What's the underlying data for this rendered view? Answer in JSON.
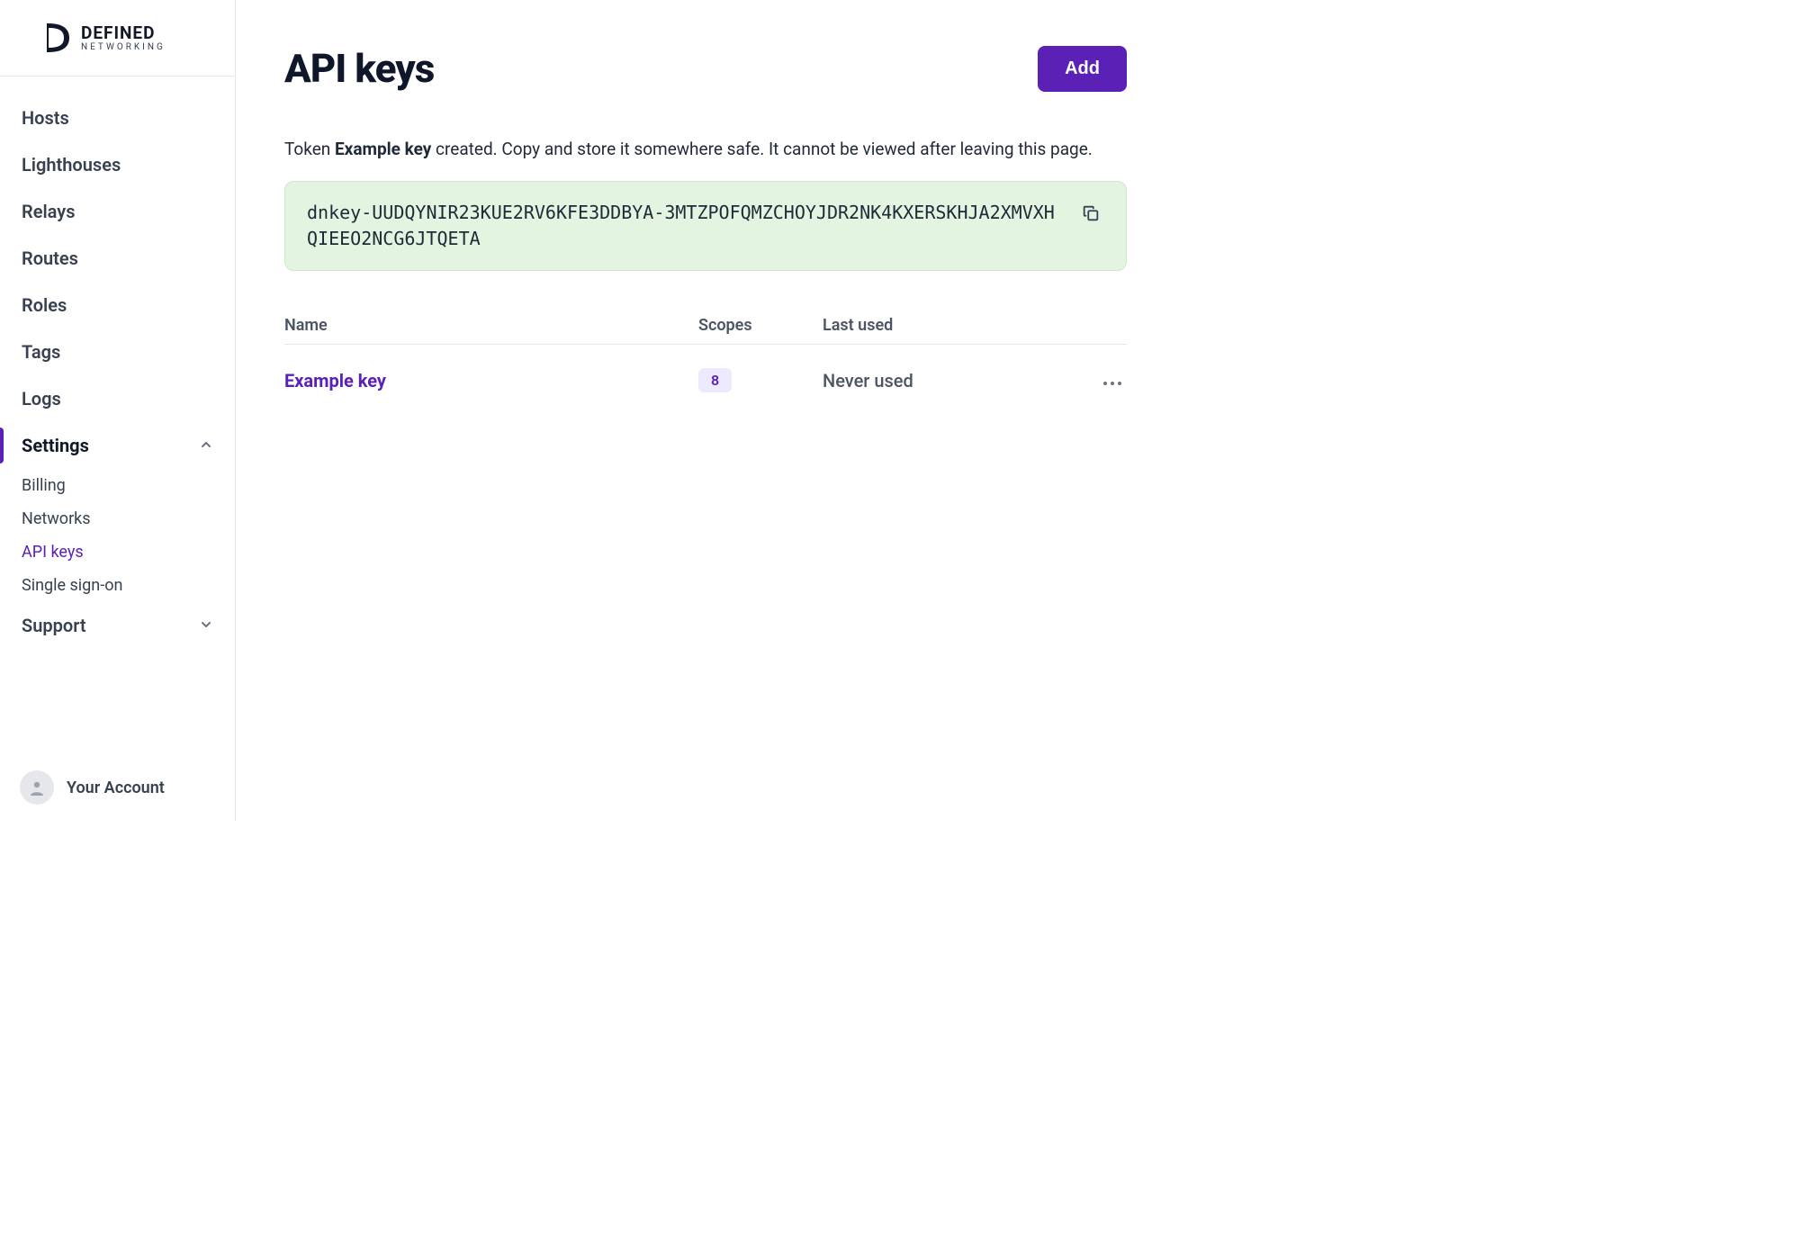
{
  "brand": {
    "name": "DEFINED",
    "subtitle": "NETWORKING"
  },
  "sidebar": {
    "items": [
      {
        "label": "Hosts"
      },
      {
        "label": "Lighthouses"
      },
      {
        "label": "Relays"
      },
      {
        "label": "Routes"
      },
      {
        "label": "Roles"
      },
      {
        "label": "Tags"
      },
      {
        "label": "Logs"
      }
    ],
    "settings_label": "Settings",
    "settings_children": [
      {
        "label": "Billing"
      },
      {
        "label": "Networks"
      },
      {
        "label": "API keys",
        "active": true
      },
      {
        "label": "Single sign-on"
      }
    ],
    "support_label": "Support",
    "account_label": "Your Account"
  },
  "page": {
    "title": "API keys",
    "add_button": "Add",
    "notice_prefix": "Token ",
    "notice_key_name": "Example key",
    "notice_suffix": " created. Copy and store it somewhere safe. It cannot be viewed after leaving this page.",
    "token_value": "dnkey-UUDQYNIR23KUE2RV6KFE3DDBYA-3MTZPOFQMZCHOYJDR2NK4KXERSKHJA2XMVXHQIEEO2NCG6JTQETA"
  },
  "table": {
    "headers": {
      "name": "Name",
      "scopes": "Scopes",
      "last_used": "Last used"
    },
    "rows": [
      {
        "name": "Example key",
        "scopes": "8",
        "last_used": "Never used"
      }
    ]
  }
}
